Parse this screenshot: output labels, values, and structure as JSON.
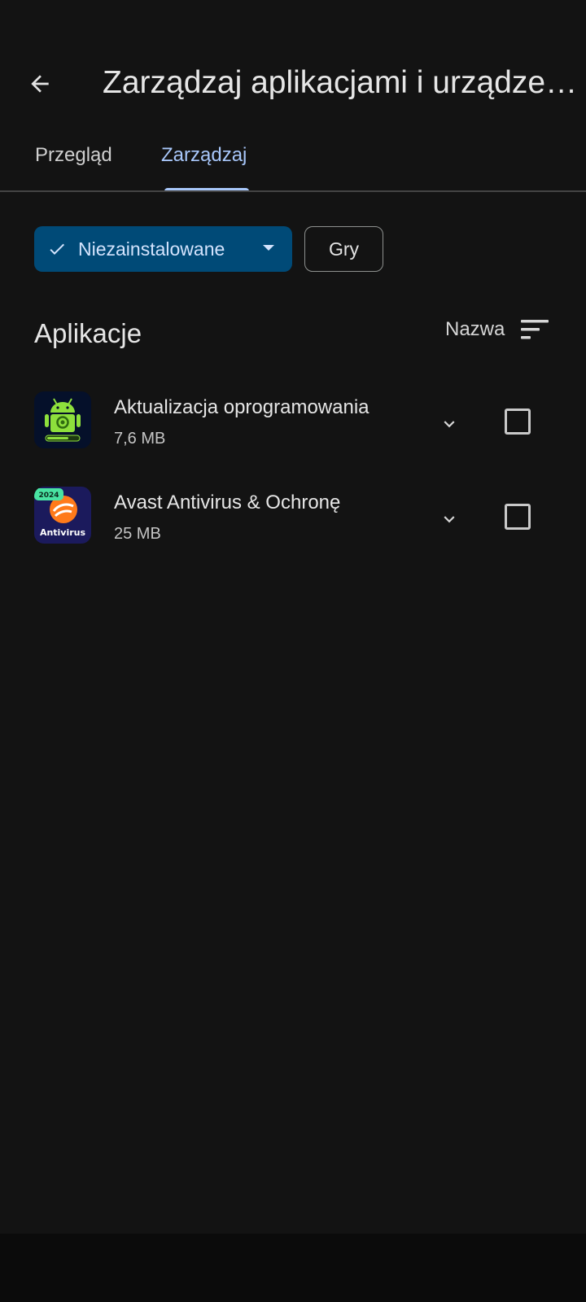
{
  "header": {
    "back_icon": "arrow-back-icon",
    "title": "Zarządzaj aplikacjami i urządzeni…"
  },
  "tabs": [
    {
      "label": "Przegląd",
      "active": false
    },
    {
      "label": "Zarządzaj",
      "active": true
    }
  ],
  "filters": {
    "uninstalled": {
      "label": "Niezainstalowane",
      "selected": true,
      "icon": "check-icon",
      "dropdown_icon": "caret-down-icon"
    },
    "games": {
      "label": "Gry",
      "selected": false
    }
  },
  "section": {
    "title": "Aplikacje",
    "sort_label": "Nazwa",
    "sort_icon": "sort-icon"
  },
  "apps": [
    {
      "name": "Aktualizacja oprogramowania",
      "size": "7,6 MB",
      "checked": false
    },
    {
      "name": "Avast Antivirus & Ochronę",
      "size": "25 MB",
      "checked": false,
      "icon_badge": "2024",
      "icon_text": "Antivirus"
    }
  ],
  "colors": {
    "background": "#131313",
    "accent": "#a8c7fa",
    "chip_selected_bg": "#004a77",
    "chip_selected_text": "#d3e3fd"
  }
}
